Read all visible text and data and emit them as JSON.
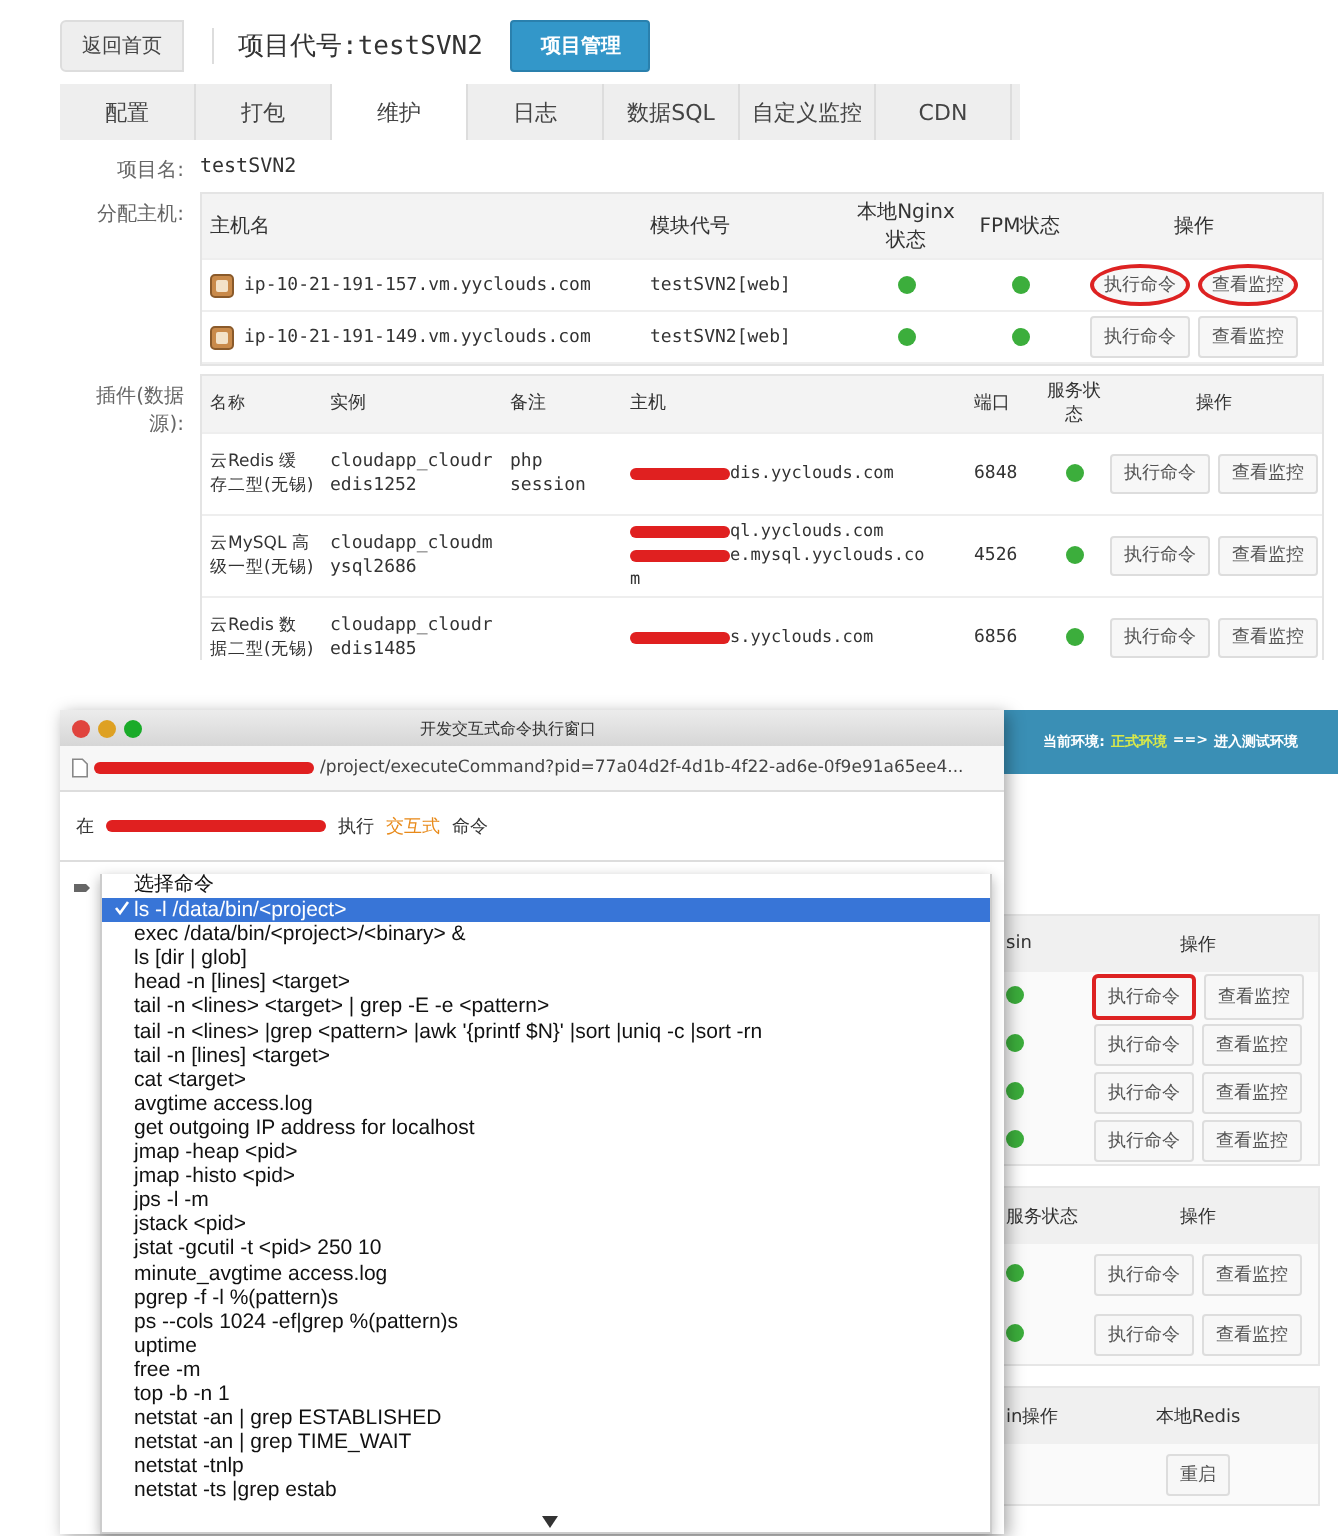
{
  "top": {
    "back_button": "返回首页",
    "title": "项目代号:testSVN2",
    "manage_button": "项目管理",
    "tabs": [
      {
        "label": "配置",
        "selected": false
      },
      {
        "label": "打包",
        "selected": false
      },
      {
        "label": "维护",
        "selected": true
      },
      {
        "label": "日志",
        "selected": false
      },
      {
        "label": "数据SQL",
        "selected": false
      },
      {
        "label": "自定义监控",
        "selected": false
      },
      {
        "label": "CDN",
        "selected": false
      }
    ],
    "project_label": "项目名:",
    "project_name": "testSVN2",
    "hosts": {
      "label": "分配主机:",
      "columns": [
        "主机名",
        "模块代号",
        "本地Nginx状态",
        "FPM状态",
        "操作"
      ],
      "rows": [
        {
          "hostname": "ip-10-21-191-157.vm.yyclouds.com",
          "module": "testSVN2[web]",
          "nginx_ok": true,
          "fpm_ok": true,
          "actions": [
            {
              "label": "执行命令",
              "circled": true
            },
            {
              "label": "查看监控",
              "circled": true
            }
          ]
        },
        {
          "hostname": "ip-10-21-191-149.vm.yyclouds.com",
          "module": "testSVN2[web]",
          "nginx_ok": true,
          "fpm_ok": true,
          "actions": [
            {
              "label": "执行命令",
              "circled": false
            },
            {
              "label": "查看监控",
              "circled": false
            }
          ]
        }
      ]
    },
    "plugins": {
      "label": "插件(数据源):",
      "columns": [
        "名称",
        "实例",
        "备注",
        "主机",
        "端口",
        "服务状态",
        "操作"
      ],
      "rows": [
        {
          "name": "云Redis 缓存二型(无锡)",
          "instance": "cloudapp_cloudredis1252",
          "note": "php session",
          "host_lines": [
            {
              "redacted": true,
              "text": "dis.yyclouds.com"
            }
          ],
          "port": "6848",
          "status_ok": true,
          "actions": [
            "执行命令",
            "查看监控"
          ]
        },
        {
          "name": "云MySQL 高级一型(无锡)",
          "instance": "cloudapp_cloudmysql2686",
          "host_lines": [
            {
              "redacted": true,
              "text": "ql.yyclouds.com"
            },
            {
              "redacted": true,
              "text": "e.mysql.yyclouds.co"
            },
            {
              "redacted": false,
              "text": "m"
            }
          ],
          "port": "4526",
          "status_ok": true,
          "actions": [
            "执行命令",
            "查看监控"
          ]
        },
        {
          "name": "云Redis 数据二型(无锡)",
          "instance": "cloudapp_cloudredis1485",
          "host_lines": [
            {
              "redacted": true,
              "text": "s.yyclouds.com"
            }
          ],
          "port": "6856",
          "status_ok": true,
          "actions": [
            "执行命令",
            "查看监控"
          ]
        }
      ]
    }
  },
  "bottom": {
    "env": {
      "label": "当前环境:",
      "current": "正式环境",
      "arrow": "==>",
      "link": "进入测试环境"
    },
    "background": {
      "table1": {
        "columns": [
          "sin",
          "操作"
        ],
        "rows": [
          {
            "ok": true,
            "actions": [
              {
                "label": "执行命令",
                "boxed": true
              },
              {
                "label": "查看监控",
                "boxed": false
              }
            ]
          },
          {
            "ok": true,
            "actions": [
              {
                "label": "执行命令",
                "boxed": false
              },
              {
                "label": "查看监控",
                "boxed": false
              }
            ]
          },
          {
            "ok": true,
            "actions": [
              {
                "label": "执行命令",
                "boxed": false
              },
              {
                "label": "查看监控",
                "boxed": false
              }
            ]
          },
          {
            "ok": true,
            "actions": [
              {
                "label": "执行命令",
                "boxed": false
              },
              {
                "label": "查看监控",
                "boxed": false
              }
            ]
          }
        ]
      },
      "table2": {
        "columns": [
          "服务状态",
          "操作"
        ],
        "rows": [
          {
            "ok": true,
            "actions": [
              "执行命令",
              "查看监控"
            ]
          },
          {
            "ok": true,
            "actions": [
              "执行命令",
              "查看监控"
            ]
          }
        ]
      },
      "table3": {
        "columns": [
          "in操作",
          "本地Redis"
        ]
      },
      "restart_button": "重启"
    },
    "dialog": {
      "title": "开发交互式命令执行窗口",
      "url": "/project/executeCommand?pid=77a04d2f-4d1b-4f22-ad6e-0f9e91a65ee4...",
      "exec_line": [
        {
          "kind": "text",
          "text": "在"
        },
        {
          "kind": "redacted"
        },
        {
          "kind": "text",
          "text": "执行"
        },
        {
          "kind": "highlight",
          "text": "交互式"
        },
        {
          "kind": "text",
          "text": "命令"
        }
      ],
      "options": [
        {
          "label": "选择命令",
          "selected": false
        },
        {
          "label": "ls -l /data/bin/<project>",
          "selected": true
        },
        {
          "label": "exec /data/bin/<project>/<binary> &",
          "selected": false
        },
        {
          "label": "ls [dir | glob]",
          "selected": false
        },
        {
          "label": "head -n [lines] <target>",
          "selected": false
        },
        {
          "label": "tail -n <lines> <target> | grep -E -e <pattern>",
          "selected": false
        },
        {
          "label": "tail -n <lines> |grep <pattern> |awk '{printf $N}' |sort |uniq -c |sort -rn",
          "selected": false
        },
        {
          "label": "tail -n [lines] <target>",
          "selected": false
        },
        {
          "label": "cat <target>",
          "selected": false
        },
        {
          "label": "avgtime access.log",
          "selected": false
        },
        {
          "label": "get outgoing IP address for localhost",
          "selected": false
        },
        {
          "label": "jmap -heap <pid>",
          "selected": false
        },
        {
          "label": "jmap -histo <pid>",
          "selected": false
        },
        {
          "label": "jps -l -m",
          "selected": false
        },
        {
          "label": "jstack <pid>",
          "selected": false
        },
        {
          "label": "jstat -gcutil -t <pid> 250 10",
          "selected": false
        },
        {
          "label": "minute_avgtime access.log",
          "selected": false
        },
        {
          "label": "pgrep -f -l %(pattern)s",
          "selected": false
        },
        {
          "label": "ps --cols 1024 -ef|grep %(pattern)s",
          "selected": false
        },
        {
          "label": "uptime",
          "selected": false
        },
        {
          "label": "free -m",
          "selected": false
        },
        {
          "label": "top -b -n 1",
          "selected": false
        },
        {
          "label": "netstat -an | grep ESTABLISHED",
          "selected": false
        },
        {
          "label": "netstat -an | grep TIME_WAIT",
          "selected": false
        },
        {
          "label": "netstat -tnlp",
          "selected": false
        },
        {
          "label": "netstat -ts |grep estab",
          "selected": false
        }
      ]
    }
  }
}
